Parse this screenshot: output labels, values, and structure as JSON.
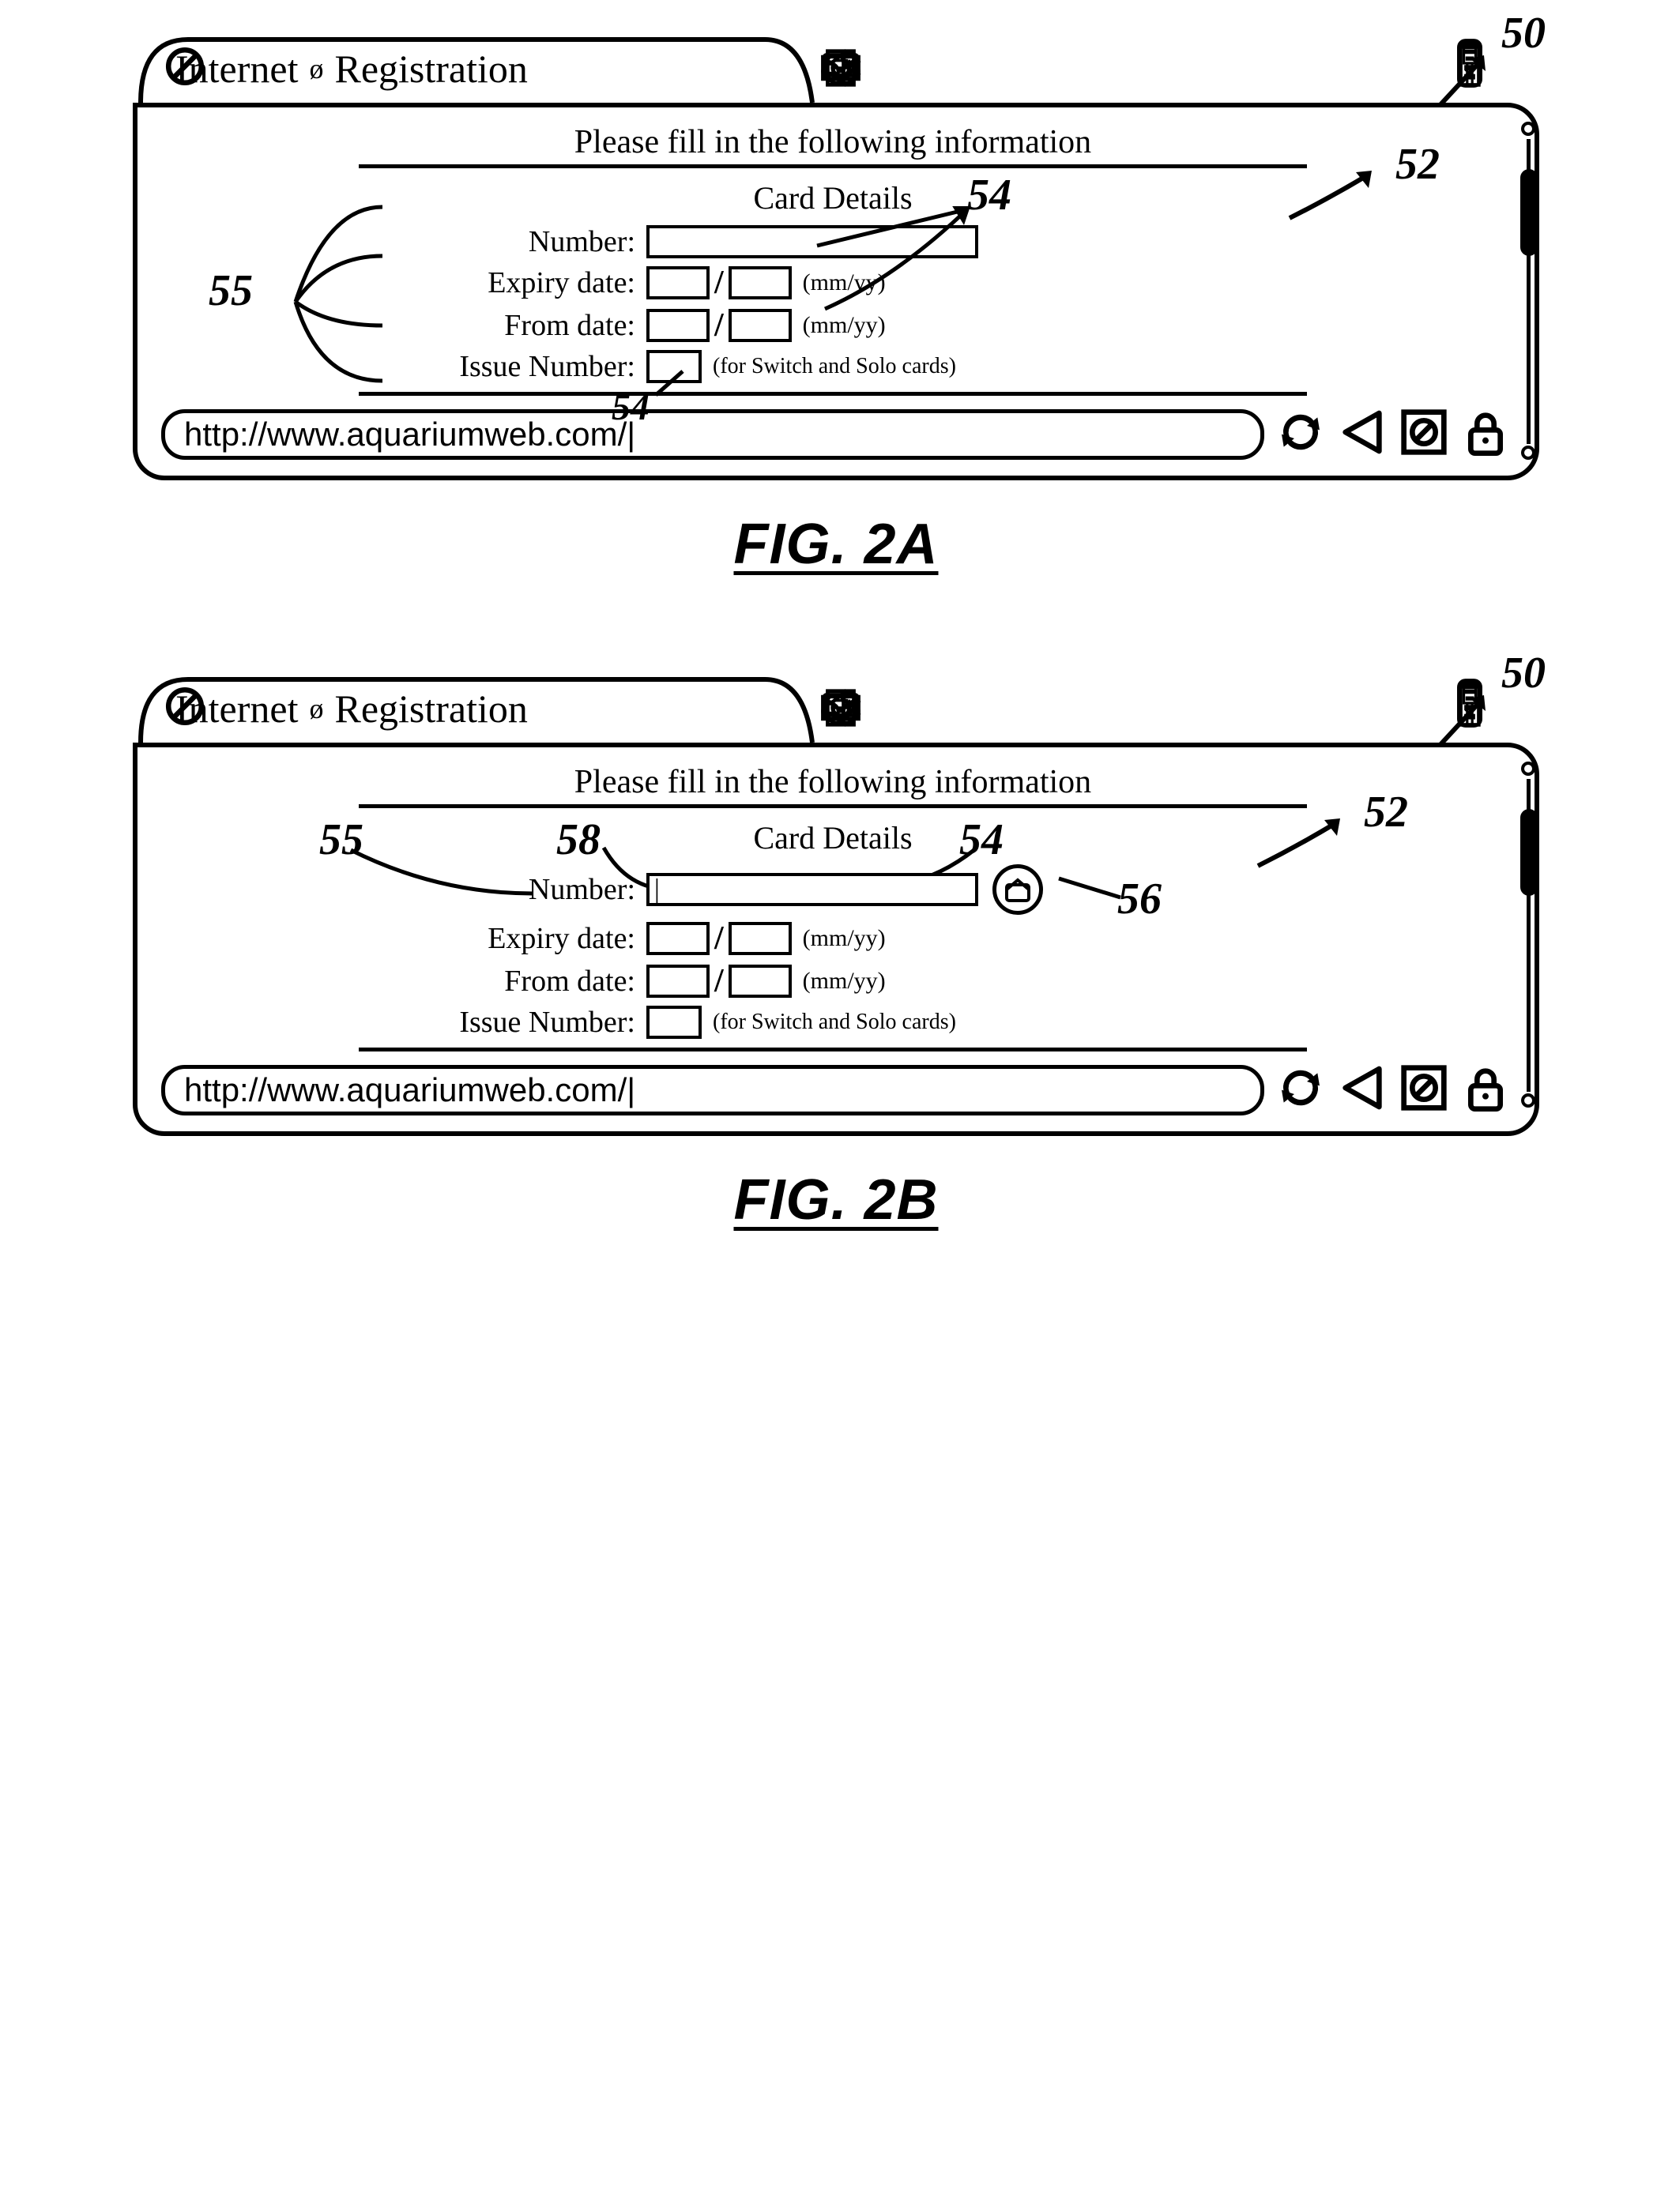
{
  "titlebar": {
    "app_label": "Internet",
    "page_label": "Registration"
  },
  "page": {
    "heading": "Please fill in the following information",
    "section": "Card Details",
    "labels": {
      "number": "Number:",
      "expiry": "Expiry date:",
      "from": "From date:",
      "issue": "Issue Number:"
    },
    "hints": {
      "mmyy": "(mm/yy)",
      "issue": "(for Switch and Solo cards)"
    }
  },
  "url": "http://www.aquariumweb.com/|",
  "refs": {
    "r50": "50",
    "r52": "52",
    "r54": "54",
    "r55": "55",
    "r56": "56",
    "r58": "58"
  },
  "fig_labels": {
    "a": "FIG. 2A",
    "b": "FIG. 2B"
  }
}
